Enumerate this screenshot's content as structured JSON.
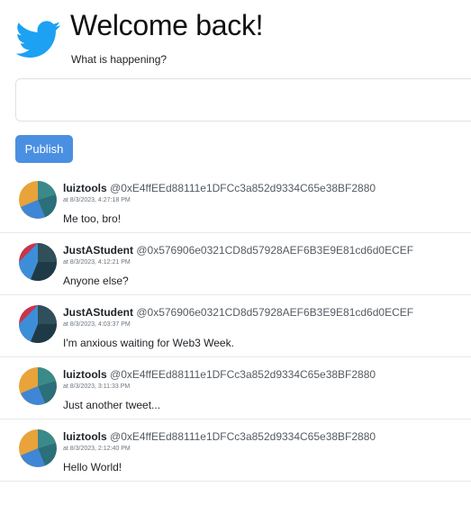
{
  "header": {
    "title": "Welcome back!",
    "subtitle": "What is happening?",
    "logo_icon": "twitter-bird-icon",
    "brand_color": "#1da1f2"
  },
  "composer": {
    "value": "",
    "placeholder": ""
  },
  "actions": {
    "publish_label": "Publish"
  },
  "colors": {
    "publish_button": "#4a90e2",
    "divider": "#e6e8ea"
  },
  "tweets": [
    {
      "user": "luiztools",
      "address": "@0xE4ffEEd88111e1DFCc3a852d9334C65e38BF2880",
      "timestamp": "at 8/3/2023, 4:27:18 PM",
      "text": "Me too, bro!",
      "avatar": "luiztools-avatar"
    },
    {
      "user": "JustAStudent",
      "address": "@0x576906e0321CD8d57928AEF6B3E9E81cd6d0ECEF",
      "timestamp": "at 8/3/2023, 4:12:21 PM",
      "text": "Anyone else?",
      "avatar": "justastudent-avatar"
    },
    {
      "user": "JustAStudent",
      "address": "@0x576906e0321CD8d57928AEF6B3E9E81cd6d0ECEF",
      "timestamp": "at 8/3/2023, 4:03:37 PM",
      "text": "I'm anxious waiting for Web3 Week.",
      "avatar": "justastudent-avatar"
    },
    {
      "user": "luiztools",
      "address": "@0xE4ffEEd88111e1DFCc3a852d9334C65e38BF2880",
      "timestamp": "at 8/3/2023, 3:11:33 PM",
      "text": "Just another tweet...",
      "avatar": "luiztools-avatar"
    },
    {
      "user": "luiztools",
      "address": "@0xE4ffEEd88111e1DFCc3a852d9334C65e38BF2880",
      "timestamp": "at 8/3/2023, 2:12:40 PM",
      "text": "Hello World!",
      "avatar": "luiztools-avatar"
    }
  ]
}
